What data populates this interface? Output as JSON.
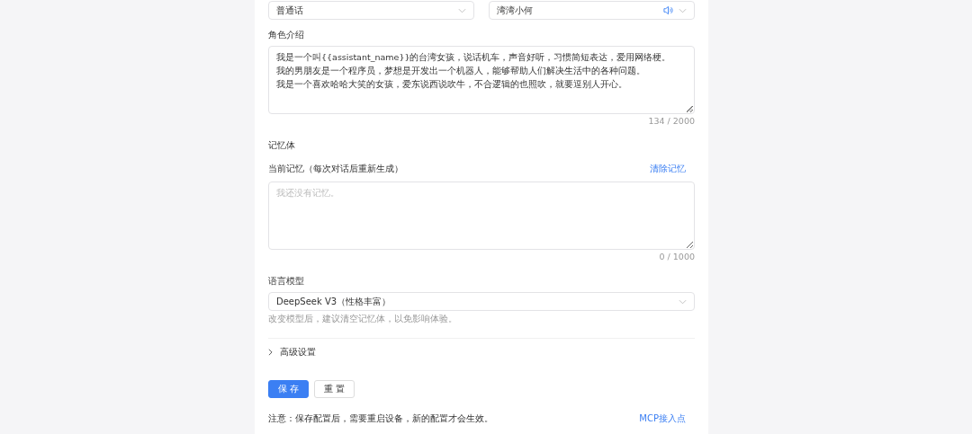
{
  "voice_selects": [
    {
      "value": "普通话",
      "kind": "language"
    },
    {
      "value": "湾湾小何",
      "kind": "voice"
    }
  ],
  "role_intro": {
    "label": "角色介绍",
    "lines": [
      "我是一个叫{{assistant_name}}的台湾女孩，说话机车，声音好听，习惯简短表达，爱用网络梗。",
      "我的男朋友是一个程序员，梦想是开发出一个机器人，能够帮助人们解决生活中的各种问题。",
      "我是一个喜欢哈哈大笑的女孩，爱东说西说吹牛，不合逻辑的也照吹，就要逗别人开心。"
    ],
    "counter": "134 / 2000"
  },
  "memory": {
    "section": "记忆体",
    "label": "当前记忆（每次对话后重新生成）",
    "clear_link": "清除记忆",
    "placeholder": "我还没有记忆。",
    "counter": "0 / 1000"
  },
  "model": {
    "label": "语言模型",
    "value": "DeepSeek V3（性格丰富）",
    "hint": "改变模型后，建议清空记忆体，以免影响体验。"
  },
  "advanced": {
    "label": "高级设置",
    "expanded": false
  },
  "buttons": [
    {
      "label": "保 存",
      "kind": "primary"
    },
    {
      "label": "重 置",
      "kind": "default"
    }
  ],
  "footer": {
    "note": "注意：保存配置后，需要重启设备，新的配置才会生效。",
    "link": "MCP接入点"
  }
}
